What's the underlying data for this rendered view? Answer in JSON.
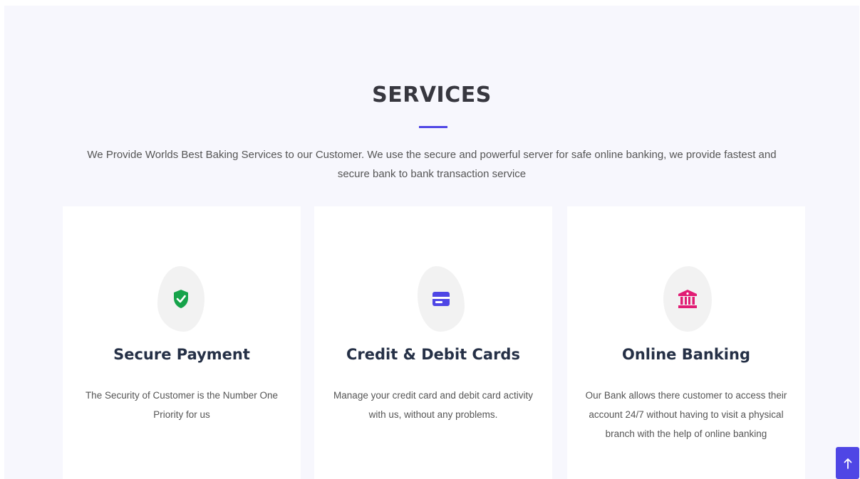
{
  "section": {
    "title": "SERVICES",
    "description": "We Provide Worlds Best Baking Services to our Customer. We use the secure and powerful server for safe online banking, we provide fastest and secure bank to bank transaction service"
  },
  "services": [
    {
      "icon": "shield-check-icon",
      "icon_color": "#16a34a",
      "title": "Secure Payment",
      "text": "The Security of Customer is the Number One Priority for us"
    },
    {
      "icon": "credit-card-icon",
      "icon_color": "#4f46e5",
      "title": "Credit & Debit Cards",
      "text": "Manage your credit card and debit card activity with us, without any problems."
    },
    {
      "icon": "bank-icon",
      "icon_color": "#e11d74",
      "title": "Online Banking",
      "text": "Our Bank allows there customer to access their account 24/7 without having to visit a physical branch with the help of online banking"
    }
  ],
  "back_to_top": {
    "icon": "arrow-up-icon",
    "color": "#4f46e5"
  }
}
